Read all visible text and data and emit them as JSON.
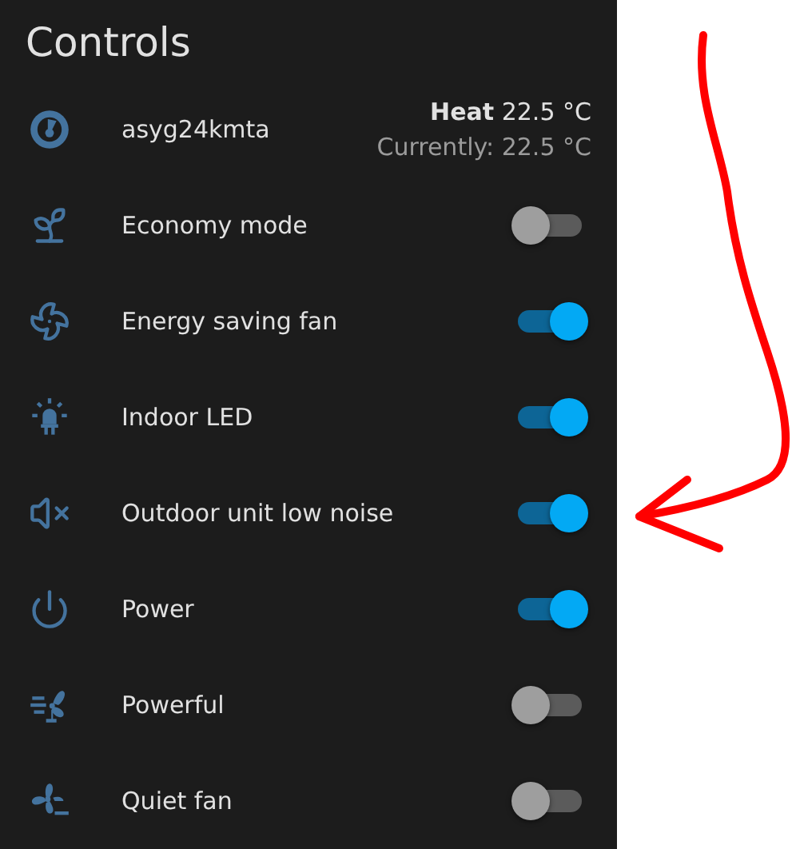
{
  "card": {
    "title": "Controls",
    "rows": [
      {
        "kind": "climate",
        "name": "asyg24kmta",
        "state": "**Heat** 22.5 °C",
        "current": "Currently: 22.5 °C"
      },
      {
        "kind": "switch",
        "name": "Economy mode",
        "on": false
      },
      {
        "kind": "switch",
        "name": "Energy saving fan",
        "on": true
      },
      {
        "kind": "switch",
        "name": "Indoor LED",
        "on": true
      },
      {
        "kind": "switch",
        "name": "Outdoor unit low noise",
        "on": true
      },
      {
        "kind": "switch",
        "name": "Power",
        "on": true
      },
      {
        "kind": "switch",
        "name": "Powerful",
        "on": false
      },
      {
        "kind": "switch",
        "name": "Quiet fan",
        "on": false
      }
    ]
  }
}
